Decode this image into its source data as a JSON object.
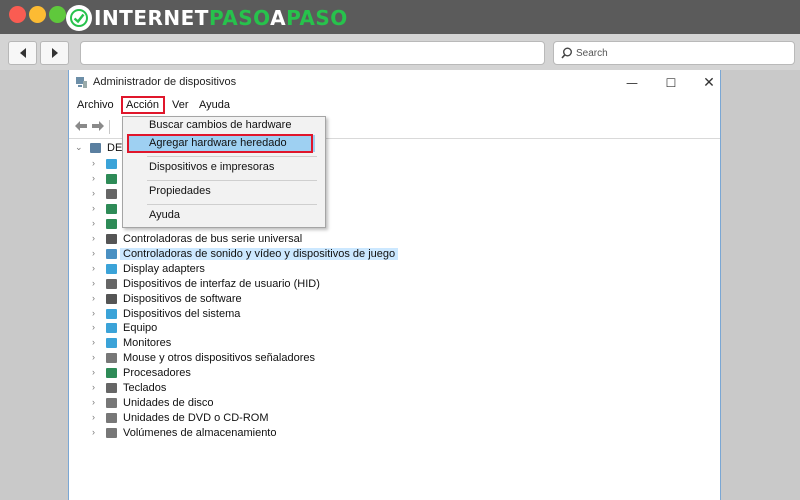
{
  "browser": {
    "logo_part1": "INTERNET",
    "logo_part2": "PASO",
    "logo_part3": "A",
    "logo_part4": "PASO",
    "search_placeholder": "Search",
    "accent_color": "#27c24c"
  },
  "window": {
    "title": "Administrador de dispositivos",
    "controls": {
      "minimize": "—",
      "maximize": "☐",
      "close": "✕"
    }
  },
  "menubar": {
    "archivo": "Archivo",
    "accion": "Acción",
    "ver": "Ver",
    "ayuda": "Ayuda"
  },
  "tree": {
    "root_label": "DE",
    "items": [
      {
        "label": "",
        "icon": "network-icon",
        "color": "#3ba3d8"
      },
      {
        "label": "",
        "icon": "globe-icon",
        "color": "#2e8b57"
      },
      {
        "label": "",
        "icon": "keyboard-icon",
        "color": "#666666"
      },
      {
        "label": "",
        "icon": "printer-icon",
        "color": "#2e8b57"
      },
      {
        "label": "",
        "icon": "battery-icon",
        "color": "#2e8b57"
      },
      {
        "label": "Controladoras de bus serie universal",
        "icon": "usb-icon",
        "color": "#555555"
      },
      {
        "label": "Controladoras de sonido y vídeo y dispositivos de juego",
        "icon": "speaker-icon",
        "color": "#4a90c2"
      },
      {
        "label": "Display adapters",
        "icon": "display-adapter-icon",
        "color": "#3ba3d8"
      },
      {
        "label": "Dispositivos de interfaz de usuario (HID)",
        "icon": "hid-icon",
        "color": "#666666"
      },
      {
        "label": "Dispositivos de software",
        "icon": "software-icon",
        "color": "#555555"
      },
      {
        "label": "Dispositivos del sistema",
        "icon": "system-icon",
        "color": "#3ba3d8"
      },
      {
        "label": "Equipo",
        "icon": "computer-icon",
        "color": "#3ba3d8"
      },
      {
        "label": "Monitores",
        "icon": "monitor-icon",
        "color": "#3ba3d8"
      },
      {
        "label": "Mouse y otros dispositivos señaladores",
        "icon": "mouse-icon",
        "color": "#777777"
      },
      {
        "label": "Procesadores",
        "icon": "processor-icon",
        "color": "#2e8b57"
      },
      {
        "label": "Teclados",
        "icon": "keyboard-icon",
        "color": "#666666"
      },
      {
        "label": "Unidades de disco",
        "icon": "disk-icon",
        "color": "#777777"
      },
      {
        "label": "Unidades de DVD o CD-ROM",
        "icon": "dvd-icon",
        "color": "#777777"
      },
      {
        "label": "Volúmenes de almacenamiento",
        "icon": "storage-icon",
        "color": "#777777"
      }
    ]
  },
  "menu": {
    "buscar": "Buscar cambios de hardware",
    "agregar": "Agregar hardware heredado",
    "dispositivos": "Dispositivos e impresoras",
    "propiedades": "Propiedades",
    "ayuda": "Ayuda"
  },
  "highlight_color": "#e0162b",
  "selection_color": "#cce8ff"
}
